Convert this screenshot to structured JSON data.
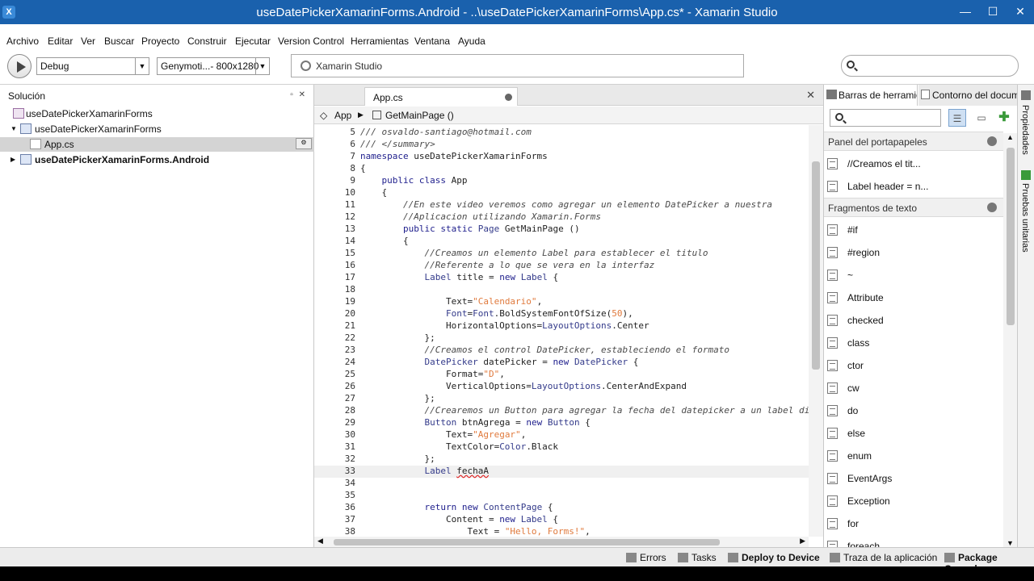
{
  "window": {
    "title": "useDatePickerXamarinForms.Android - ..\\useDatePickerXamarinForms\\App.cs* - Xamarin Studio",
    "minimize": "—",
    "maximize": "☐",
    "close": "✕"
  },
  "menu": [
    "Archivo",
    "Editar",
    "Ver",
    "Buscar",
    "Proyecto",
    "Construir",
    "Ejecutar",
    "Version Control",
    "Herramientas",
    "Ventana",
    "Ayuda"
  ],
  "toolbar": {
    "config": "Debug",
    "device": "Genymoti...- 800x1280",
    "status": "Xamarin Studio",
    "search_placeholder": ""
  },
  "solution": {
    "header": "Solución",
    "items": [
      {
        "label": "useDatePickerXamarinForms",
        "bold": false
      },
      {
        "label": "useDatePickerXamarinForms",
        "bold": false
      },
      {
        "label": "App.cs",
        "bold": false
      },
      {
        "label": "useDatePickerXamarinForms.Android",
        "bold": true
      }
    ]
  },
  "editor": {
    "tab_label": "App.cs",
    "breadcrumb": [
      "App",
      "GetMainPage ()"
    ],
    "current_line": 33,
    "lines": [
      {
        "n": "5",
        "code": "/// osvaldo-santiago@hotmail.com"
      },
      {
        "n": "6",
        "code": "/// </summary>"
      },
      {
        "n": "7",
        "code": "namespace useDatePickerXamarinForms"
      },
      {
        "n": "8",
        "code": "{"
      },
      {
        "n": "9",
        "code": "    public class App"
      },
      {
        "n": "10",
        "code": "    {"
      },
      {
        "n": "11",
        "code": "        //En este video veremos como agregar un elemento DatePicker a nuestra"
      },
      {
        "n": "12",
        "code": "        //Aplicacion utilizando Xamarin.Forms"
      },
      {
        "n": "13",
        "code": "        public static Page GetMainPage ()"
      },
      {
        "n": "14",
        "code": "        {"
      },
      {
        "n": "15",
        "code": "            //Creamos un elemento Label para establecer el titulo"
      },
      {
        "n": "16",
        "code": "            //Referente a lo que se vera en la interfaz"
      },
      {
        "n": "17",
        "code": "            Label title = new Label {"
      },
      {
        "n": "18",
        "code": ""
      },
      {
        "n": "19",
        "code": "                Text=\"Calendario\","
      },
      {
        "n": "20",
        "code": "                Font=Font.BoldSystemFontOfSize(50),"
      },
      {
        "n": "21",
        "code": "                HorizontalOptions=LayoutOptions.Center"
      },
      {
        "n": "22",
        "code": "            };"
      },
      {
        "n": "23",
        "code": "            //Creamos el control DatePicker, estableciendo el formato"
      },
      {
        "n": "24",
        "code": "            DatePicker datePicker = new DatePicker {"
      },
      {
        "n": "25",
        "code": "                Format=\"D\","
      },
      {
        "n": "26",
        "code": "                VerticalOptions=LayoutOptions.CenterAndExpand"
      },
      {
        "n": "27",
        "code": "            };"
      },
      {
        "n": "28",
        "code": "            //Crearemos un Button para agregar la fecha del datepicker a un label dif"
      },
      {
        "n": "29",
        "code": "            Button btnAgrega = new Button {"
      },
      {
        "n": "30",
        "code": "                Text=\"Agregar\","
      },
      {
        "n": "31",
        "code": "                TextColor=Color.Black"
      },
      {
        "n": "32",
        "code": "            };"
      },
      {
        "n": "33",
        "code": "            Label fechaA"
      },
      {
        "n": "34",
        "code": ""
      },
      {
        "n": "35",
        "code": ""
      },
      {
        "n": "36",
        "code": "            return new ContentPage {"
      },
      {
        "n": "37",
        "code": "                Content = new Label {"
      },
      {
        "n": "38",
        "code": "                    Text = \"Hello, Forms!\","
      }
    ]
  },
  "toolbox": {
    "tabs": [
      "Barras de herramientas",
      "Contorno del documento"
    ],
    "sections": [
      {
        "title": "Panel del portapapeles",
        "items": [
          "//Creamos el tit...",
          "Label header = n..."
        ]
      },
      {
        "title": "Fragmentos de texto",
        "items": [
          "#if",
          "#region",
          "~",
          "Attribute",
          "checked",
          "class",
          "ctor",
          "cw",
          "do",
          "else",
          "enum",
          "EventArgs",
          "Exception",
          "for",
          "foreach"
        ]
      }
    ]
  },
  "right_strip": [
    "Propiedades",
    "Pruebas unitarias"
  ],
  "statusbar": {
    "items": [
      "Errors",
      "Tasks",
      "Deploy to Device",
      "Traza de la aplicación",
      "Package Console"
    ]
  },
  "colors": {
    "titlebar": "#1a61ad",
    "selection": "#d4d4d4",
    "comment": "#4a4a4a",
    "keyword": "#1e1e8c",
    "string": "#e07a3d"
  }
}
